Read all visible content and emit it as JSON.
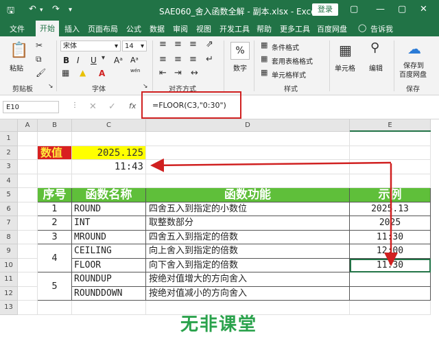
{
  "titlebar": {
    "title": "SAE060_舍入函数全解 - 副本.xlsx  -  Excel",
    "login": "登录",
    "save_icon": "save-icon",
    "undo_icon": "undo-icon",
    "redo_icon": "redo-icon",
    "window_buttons": [
      "▢",
      "—",
      "▢",
      "✕"
    ]
  },
  "menu": {
    "tabs": [
      "文件",
      "开始",
      "插入",
      "页面布局",
      "公式",
      "数据",
      "审阅",
      "视图",
      "开发工具",
      "帮助",
      "更多工具",
      "百度网盘"
    ],
    "tell_me": "告诉我"
  },
  "ribbon": {
    "paste": "粘贴",
    "clipboard": "剪贴板",
    "font_name": "宋体",
    "font_size": "14",
    "bold": "B",
    "italic": "I",
    "underline": "U",
    "font_group": "字体",
    "align_group": "对齐方式",
    "number": "数字",
    "number_symbol": "%",
    "cond_format": "条件格式",
    "table_format": "套用表格格式",
    "cell_style": "单元格样式",
    "style_group": "样式",
    "cells": "单元格",
    "editing": "编辑",
    "save_baidu": "保存到",
    "save_baidu2": "百度网盘",
    "save_group": "保存",
    "wen": "wén"
  },
  "formula_bar": {
    "name_box": "E10",
    "fx": "fx",
    "formula": "=FLOOR(C3,\"0:30\")"
  },
  "columns": [
    "A",
    "B",
    "C",
    "D",
    "E"
  ],
  "rows": [
    "1",
    "2",
    "3",
    "4",
    "5",
    "6",
    "7",
    "8",
    "9",
    "10",
    "11",
    "12",
    "13"
  ],
  "sheet": {
    "label_value": "数值",
    "c2": "2025.125",
    "c3": "11:43",
    "headers": [
      "序号",
      "函数名称",
      "函数功能",
      "示例"
    ],
    "table": [
      {
        "no": "1",
        "name": "ROUND",
        "desc": "四舍五入到指定的小数位",
        "example": "2025.13"
      },
      {
        "no": "2",
        "name": "INT",
        "desc": "取整数部分",
        "example": "2025"
      },
      {
        "no": "3",
        "name": "MROUND",
        "desc": "四舍五入到指定的倍数",
        "example": "11:30"
      },
      {
        "no": "4",
        "name": "CEILING",
        "desc": "向上舍入到指定的倍数",
        "example": "12:00"
      },
      {
        "no": "",
        "name": "FLOOR",
        "desc": "向下舍入到指定的倍数",
        "example": "11:30"
      },
      {
        "no": "5",
        "name": "ROUNDUP",
        "desc": "按绝对值增大的方向舍入",
        "example": ""
      },
      {
        "no": "",
        "name": "ROUNDDOWN",
        "desc": "按绝对值减小的方向舍入",
        "example": ""
      }
    ]
  },
  "watermark": "无非课堂",
  "colors": {
    "excel_green": "#217346",
    "table_header_green": "#5fbf3a",
    "label_red": "#d92020",
    "value_yellow": "#ffff00",
    "arrow_red": "#d02020"
  }
}
